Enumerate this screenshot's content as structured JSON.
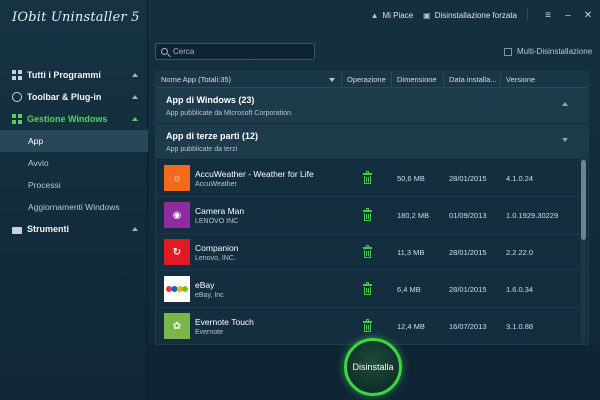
{
  "app": {
    "title": "IObit Uninstaller 5"
  },
  "topbar": {
    "like_label": "Mi Piace",
    "force_uninstall_label": "Disinstallazione forzata"
  },
  "sidebar": {
    "groups": [
      {
        "label": "Tutti i Programmi",
        "icon": "grid-icon"
      },
      {
        "label": "Toolbar & Plug-in",
        "icon": "globe-icon"
      },
      {
        "label": "Gestione Windows",
        "icon": "windows-icon",
        "active": true
      },
      {
        "label": "Strumenti",
        "icon": "toolbox-icon"
      }
    ],
    "subitems": [
      {
        "label": "App",
        "selected": true
      },
      {
        "label": "Avvio"
      },
      {
        "label": "Processi"
      },
      {
        "label": "Aggiornamenti Windows"
      }
    ]
  },
  "search": {
    "placeholder": "Cerca",
    "value": ""
  },
  "multi_uninstall": {
    "label": "Multi-Disinstallazione",
    "checked": false
  },
  "table": {
    "columns": {
      "name": "Nome App (Totali:35)",
      "operation": "Operazione",
      "size": "Dimensione",
      "date": "Data installa...",
      "version": "Versione"
    },
    "groups": [
      {
        "title": "App di Windows (23)",
        "subtitle": "App pubblicate da Microsoft Corporation.",
        "collapsed": true
      },
      {
        "title": "App di terze parti (12)",
        "subtitle": "App pubblicate da terzi",
        "collapsed": false
      }
    ],
    "rows": [
      {
        "name": "AccuWeather - Weather for Life",
        "publisher": "AccuWeather",
        "size": "50,6 MB",
        "date": "28/01/2015",
        "version": "4.1.0.24",
        "icon": "sun-icon",
        "color": "#f26a1b"
      },
      {
        "name": "Camera Man",
        "publisher": "LENOVO INC",
        "size": "180,2 MB",
        "date": "01/09/2013",
        "version": "1.0.1929.30229",
        "icon": "camera-icon",
        "color": "#8e2ca0"
      },
      {
        "name": "Companion",
        "publisher": "Lenovo, INC.",
        "size": "11,3 MB",
        "date": "28/01/2015",
        "version": "2.2.22.0",
        "icon": "companion-icon",
        "color": "#e01b23"
      },
      {
        "name": "eBay",
        "publisher": "eBay, Inc",
        "size": "6,4 MB",
        "date": "28/01/2015",
        "version": "1.6.0.34",
        "icon": "ebay-icon",
        "color": "#ffffff"
      },
      {
        "name": "Evernote Touch",
        "publisher": "Evernote",
        "size": "12,4 MB",
        "date": "16/07/2013",
        "version": "3.1.0.88",
        "icon": "evernote-icon",
        "color": "#7ab648"
      }
    ]
  },
  "bottom": {
    "uninstall_label": "Disinstalla"
  },
  "colors": {
    "accent": "#3fd543",
    "background": "#10283a"
  }
}
